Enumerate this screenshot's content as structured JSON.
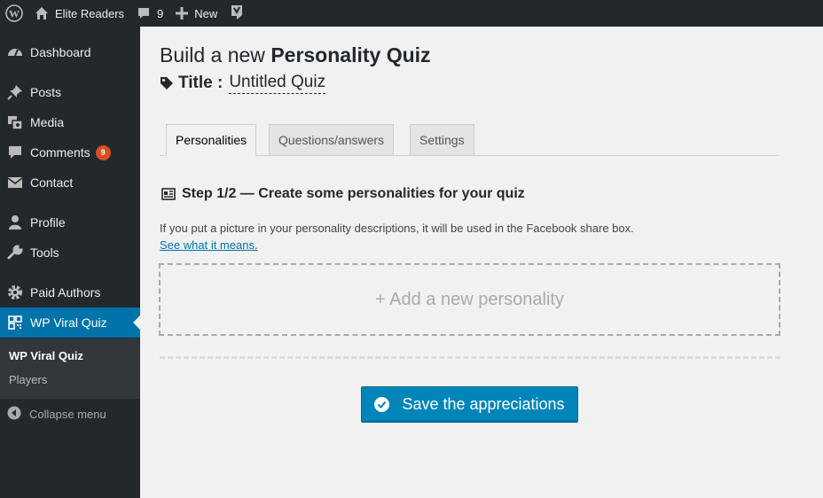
{
  "adminbar": {
    "site_name": "Elite Readers",
    "comments_count": "9",
    "new_label": "New"
  },
  "sidebar": {
    "items": [
      {
        "label": "Dashboard",
        "icon": "dashboard-icon"
      },
      {
        "label": "Posts",
        "icon": "pin-icon"
      },
      {
        "label": "Media",
        "icon": "media-icon"
      },
      {
        "label": "Comments",
        "icon": "comment-icon",
        "badge": "9"
      },
      {
        "label": "Contact",
        "icon": "mail-icon"
      },
      {
        "label": "Profile",
        "icon": "user-icon"
      },
      {
        "label": "Tools",
        "icon": "wrench-icon"
      },
      {
        "label": "Paid Authors",
        "icon": "gear-icon"
      },
      {
        "label": "WP Viral Quiz",
        "icon": "qrcode-icon"
      }
    ],
    "submenu": [
      "WP Viral Quiz",
      "Players"
    ],
    "collapse_label": "Collapse menu"
  },
  "main": {
    "title_prefix": "Build a new ",
    "title_strong": "Personality Quiz",
    "title_label": "Title :",
    "title_value": "Untitled Quiz",
    "tabs": [
      "Personalities",
      "Questions/answers",
      "Settings"
    ],
    "step_heading": "Step 1/2 — Create some personalities for your quiz",
    "step_desc": "If you put a picture in your personality descriptions, it will be used in the Facebook share box.",
    "step_link": "See what it means.",
    "add_personality": "+ Add a new personality",
    "save_label": "Save the appreciations"
  },
  "colors": {
    "adminbar_bg": "#23282d",
    "accent": "#0073aa",
    "button": "#0085ba",
    "badge": "#d54e21"
  }
}
